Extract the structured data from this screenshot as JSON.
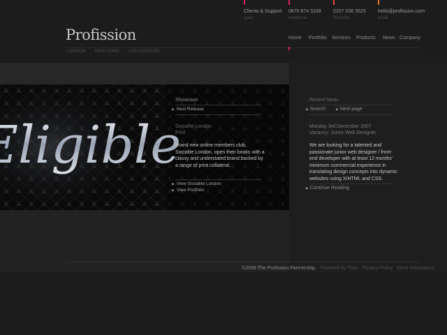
{
  "brand": {
    "logo": "Profission"
  },
  "cities": [
    "LONDON",
    "NEW YORK",
    "LOS ANGELES"
  ],
  "contacts": [
    {
      "value": "Clients & Support",
      "label": "open",
      "color": "#e0225f"
    },
    {
      "value": "0870 874 3338",
      "label": "telephone",
      "color": "#e0225f"
    },
    {
      "value": "0207 036 3525",
      "label": "facsimile",
      "color": "#e04a3a"
    },
    {
      "value": "hello@profission.com",
      "label": "email",
      "color": "#e0762a"
    }
  ],
  "nav": [
    "Home",
    "Portfolio",
    "Services",
    "Products",
    "News",
    "Company"
  ],
  "showcase": {
    "title": "Showcase",
    "next_release": "Next Release",
    "client": "Socialite London",
    "type": "Print",
    "description": "Brand new online members club, Socialite London, open their books with a classy and understated brand backed by a range of print collateral.",
    "view_client": "View Socialite London",
    "view_portfolio": "View Portfolio",
    "image_text": "Eligible"
  },
  "news": {
    "title": "Recent News",
    "search": "Search",
    "next_page": "Next page",
    "date": "Monday 3rd December 2007",
    "vacancy": "Vacancy: Junior Web Designer",
    "description": "We are looking for a talented and passionate junior web designer / front-end developer with at least 12 months' minimum commercial experience in translating design concepts into dynamic websites using X/HTML and CSS.",
    "continue": "Continue Reading"
  },
  "footer": {
    "copyright": "©2006 The Profission Partnership.",
    "powered": "Powered by Titan",
    "privacy": "Privacy Policy",
    "more": "More Information"
  }
}
